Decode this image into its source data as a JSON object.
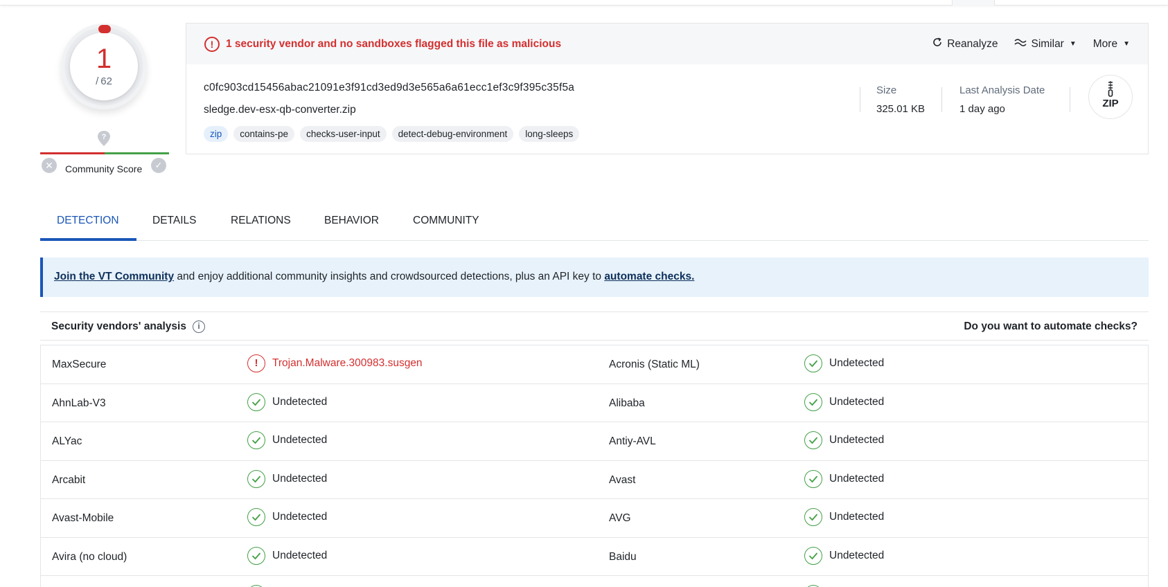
{
  "score": {
    "positives": "1",
    "total": "62",
    "community_label": "Community Score"
  },
  "alert": {
    "message": "1 security vendor and no sandboxes flagged this file as malicious"
  },
  "actions": {
    "reanalyze": "Reanalyze",
    "similar": "Similar",
    "more": "More"
  },
  "file": {
    "hash": "c0fc903cd15456abac21091e3f91cd3ed9d3e565a6a61ecc1ef3c9f395c35f5a",
    "name": "sledge.dev-esx-qb-converter.zip",
    "tags": [
      "zip",
      "contains-pe",
      "checks-user-input",
      "detect-debug-environment",
      "long-sleeps"
    ],
    "size_label": "Size",
    "size_value": "325.01 KB",
    "date_label": "Last Analysis Date",
    "date_value": "1 day ago",
    "type_badge": "ZIP"
  },
  "tabs": [
    "DETECTION",
    "DETAILS",
    "RELATIONS",
    "BEHAVIOR",
    "COMMUNITY"
  ],
  "banner": {
    "link1": "Join the VT Community",
    "middle": " and enjoy additional community insights and crowdsourced detections, plus an API key to ",
    "link2": "automate checks."
  },
  "vendors": {
    "title": "Security vendors' analysis",
    "automate": "Do you want to automate checks?",
    "rows": [
      [
        {
          "name": "MaxSecure",
          "result": "Trojan.Malware.300983.susgen",
          "status": "malicious"
        },
        {
          "name": "Acronis (Static ML)",
          "result": "Undetected",
          "status": "undetected"
        }
      ],
      [
        {
          "name": "AhnLab-V3",
          "result": "Undetected",
          "status": "undetected"
        },
        {
          "name": "Alibaba",
          "result": "Undetected",
          "status": "undetected"
        }
      ],
      [
        {
          "name": "ALYac",
          "result": "Undetected",
          "status": "undetected"
        },
        {
          "name": "Antiy-AVL",
          "result": "Undetected",
          "status": "undetected"
        }
      ],
      [
        {
          "name": "Arcabit",
          "result": "Undetected",
          "status": "undetected"
        },
        {
          "name": "Avast",
          "result": "Undetected",
          "status": "undetected"
        }
      ],
      [
        {
          "name": "Avast-Mobile",
          "result": "Undetected",
          "status": "undetected"
        },
        {
          "name": "AVG",
          "result": "Undetected",
          "status": "undetected"
        }
      ],
      [
        {
          "name": "Avira (no cloud)",
          "result": "Undetected",
          "status": "undetected"
        },
        {
          "name": "Baidu",
          "result": "Undetected",
          "status": "undetected"
        }
      ]
    ]
  },
  "colors": {
    "danger": "#d32f2f",
    "success": "#43a047",
    "accent": "#1a56b8",
    "banner_bg": "#e7f2fb"
  }
}
